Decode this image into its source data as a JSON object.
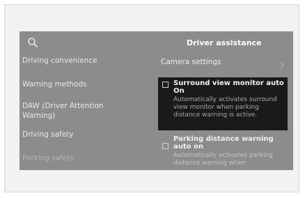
{
  "header": {
    "title": "Driver assistance",
    "search_icon": "search-icon"
  },
  "menu": {
    "items": [
      {
        "label": "Driving convenience"
      },
      {
        "label": "Warning methods"
      },
      {
        "label": "DAW (Driver Attention Warning)"
      },
      {
        "label": "Driving safety"
      },
      {
        "label": "Parking safety"
      }
    ]
  },
  "settings": {
    "camera_label": "Camera settings",
    "chevron_icon": "chevron-right-icon",
    "options": [
      {
        "title": "Surround view monitor auto On",
        "description": "Automatically activates surround view monitor when parking distance warning is active.",
        "checked": false
      },
      {
        "title": "Parking distance warning auto on",
        "description": "Automatically activates parking distance warning when",
        "checked": false
      }
    ]
  },
  "colors": {
    "screen_bg": "#8c8c8c",
    "selected_bg": "#1a1a1a"
  }
}
